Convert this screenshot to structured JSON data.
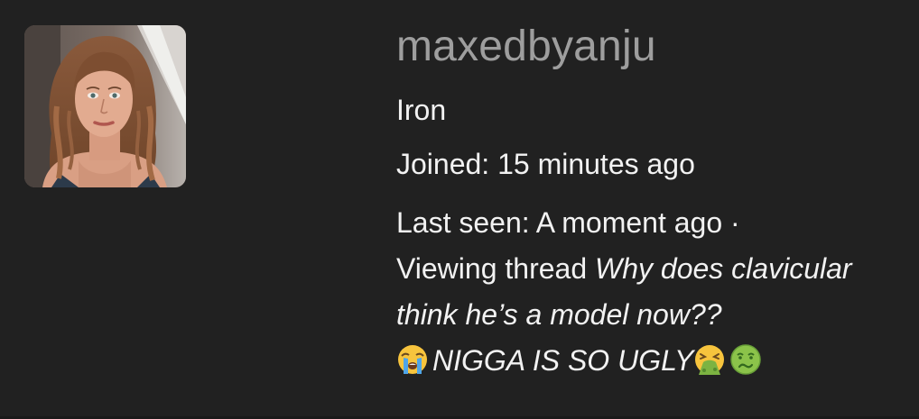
{
  "profile": {
    "username": "maxedbyanju",
    "rank": "Iron",
    "joined_label": "Joined:",
    "joined_value": "15 minutes ago",
    "last_seen_label": "Last seen:",
    "last_seen_value": "A moment ago",
    "separator": "·",
    "viewing_prefix": "Viewing thread",
    "thread_title": "Why does clavicular think he’s a model now??",
    "thread_title_tail": "NIGGA IS SO UGLY",
    "emojis": [
      "loudly-crying-face",
      "face-vomiting",
      "nauseated-face"
    ]
  },
  "colors": {
    "background": "#212121",
    "username": "#9e9e9e",
    "text": "#f2f2f2"
  }
}
